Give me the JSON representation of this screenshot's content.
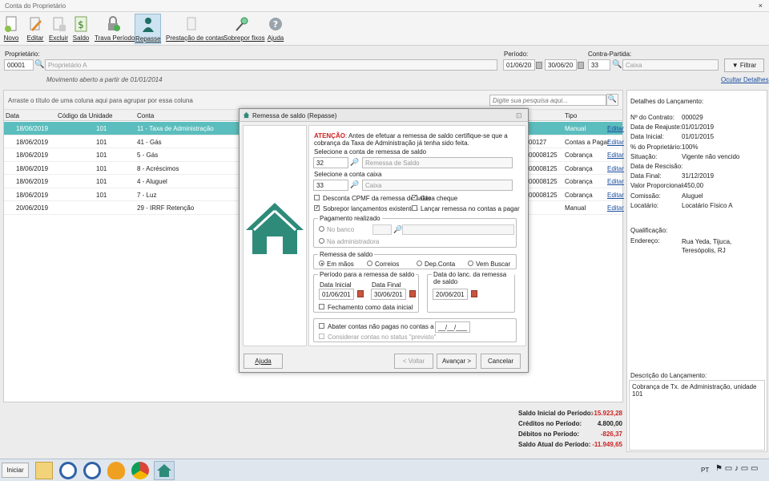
{
  "window": {
    "title": "Conta do Proprietário",
    "close": "×"
  },
  "toolbar": {
    "items": [
      "Novo",
      "Editar",
      "Excluir",
      "Saldo",
      "Trava Período",
      "Repasse",
      "Prestação de contas",
      "Sobrepor fixos",
      "Ajuda"
    ],
    "active": "Repasse"
  },
  "filters": {
    "owner_label": "Proprietário:",
    "owner_code": "00001",
    "owner_name": "Proprietário A",
    "period_label": "Período:",
    "date_from": "01/06/2019",
    "date_to": "30/06/2019",
    "contra_label": "Contra-Partida:",
    "contra_code": "33",
    "contra_name": "Caixa",
    "filter_button": "Filtrar",
    "movement_note": "Movimento aberto a partir de 01/01/2014",
    "hide_details": "Ocultar Detalhes"
  },
  "grid": {
    "group_hint": "Arraste o título de uma coluna aqui para agrupar por essa coluna",
    "search_placeholder": "Digite sua pesquisa aqui...",
    "columns": [
      "Data",
      "Código da Unidade",
      "Conta",
      "Tipo"
    ],
    "rows": [
      {
        "date": "18/06/2019",
        "unit": "101",
        "account": "11 - Taxa de Administração",
        "doc": "",
        "type": "Manual",
        "action": "Editar",
        "selected": true
      },
      {
        "date": "18/06/2019",
        "unit": "101",
        "account": "41 - Gás",
        "doc": "00127",
        "type": "Contas a Pagar",
        "action": "Editar",
        "selected": false
      },
      {
        "date": "18/06/2019",
        "unit": "101",
        "account": "5 - Gás",
        "doc": "00008125",
        "type": "Cobrança",
        "action": "Editar",
        "selected": false
      },
      {
        "date": "18/06/2019",
        "unit": "101",
        "account": "8 - Acréscimos",
        "doc": "00008125",
        "type": "Cobrança",
        "action": "Editar",
        "selected": false
      },
      {
        "date": "18/06/2019",
        "unit": "101",
        "account": "4 - Aluguel",
        "doc": "00008125",
        "type": "Cobrança",
        "action": "Editar",
        "selected": false
      },
      {
        "date": "18/06/2019",
        "unit": "101",
        "account": "7 - Luz",
        "doc": "00008125",
        "type": "Cobrança",
        "action": "Editar",
        "selected": false
      },
      {
        "date": "20/06/2019",
        "unit": "",
        "account": "29 - IRRF Retenção",
        "doc": "",
        "type": "Manual",
        "action": "Editar",
        "selected": false
      }
    ]
  },
  "totals": [
    {
      "label": "Saldo Inicial do Período:",
      "value": "-15.923,28",
      "color": "#cc2222"
    },
    {
      "label": "Créditos no Período:",
      "value": "4.800,00",
      "color": "#222222"
    },
    {
      "label": "Débitos no Período:",
      "value": "-826,37",
      "color": "#cc2222"
    },
    {
      "label": "Saldo Atual do Período:",
      "value": "-11.949,65",
      "color": "#cc2222"
    }
  ],
  "details": {
    "title": "Detalhes do Lançamento:",
    "fields": [
      {
        "k": "Nº do Contrato:",
        "v": "000029"
      },
      {
        "k": "Data de Reajuste:",
        "v": "01/01/2019"
      },
      {
        "k": "Data Inicial:",
        "v": "01/01/2015"
      },
      {
        "k": "% do Proprietário:",
        "v": "100%"
      },
      {
        "k": "Situação:",
        "v": "Vigente não vencido"
      },
      {
        "k": "Data de Rescisão:",
        "v": ""
      },
      {
        "k": "Data Final:",
        "v": "31/12/2019"
      },
      {
        "k": "Valor Proporcional:",
        "v": "-450,00"
      },
      {
        "k": "Comissão:",
        "v": "Aluguel"
      },
      {
        "k": "Locatário:",
        "v": "Locatário Físico A"
      }
    ],
    "qual_label": "Qualificação:",
    "address_label": "Endereço:",
    "address_value": "Rua Yeda, Tijuca, Teresópolis, RJ",
    "desc_label": "Descrição do Lançamento:",
    "desc_value": "Cobrança de Tx. de Administração, unidade 101"
  },
  "dialog": {
    "title": "Remessa de saldo (Repasse)",
    "warning_strong": "ATENÇÃO",
    "warning_text": ": Antes de efetuar a remessa de saldo certifique-se que a cobrança da Taxa de Administração já tenha sido feita.",
    "acc_label": "Selecione a conta de remessa de saldo",
    "acc_code": "32",
    "acc_name": "Remessa de Saldo",
    "cash_label": "Selecione a conta caixa",
    "cash_code": "33",
    "cash_name": "Caixa",
    "chk_cpmf": "Desconta CPMF da remessa de saldo",
    "chk_cheque": "Gera cheque",
    "chk_overwrite": "Sobrepor lançamentos existentes",
    "chk_launch": "Lançar remessa no contas a pagar",
    "pay_group": "Pagamento realizado",
    "pay_bank": "No banco",
    "pay_admin": "Na administradora",
    "rem_group": "Remessa de saldo",
    "rem_options": [
      "Em mãos",
      "Correios",
      "Dep.Conta",
      "Vem Buscar"
    ],
    "period_group": "Período para a remessa de saldo",
    "initial_label": "Data Inicial",
    "final_label": "Data Final",
    "initial": "01/06/2019",
    "final": "30/06/2019",
    "closing": "Fechamento como data inicial",
    "launch_group": "Data do lanc. da remessa de saldo",
    "launch_date": "20/06/2019",
    "abate": "Abater contas não pagas no contas a pagar até",
    "abate_value": "__/__/____",
    "consider": "Considerar contas no status \"previsto\"",
    "btn_help": "Ajuda",
    "btn_back": "< Voltar",
    "btn_next": "Avançar >",
    "btn_cancel": "Cancelar"
  },
  "taskbar": {
    "start": "Iniciar",
    "lang": "PT"
  },
  "colors": {
    "accent": "#5bbdbd",
    "brand": "#2e8b7a",
    "link": "#1b4e9e",
    "negative": "#cc2222"
  }
}
